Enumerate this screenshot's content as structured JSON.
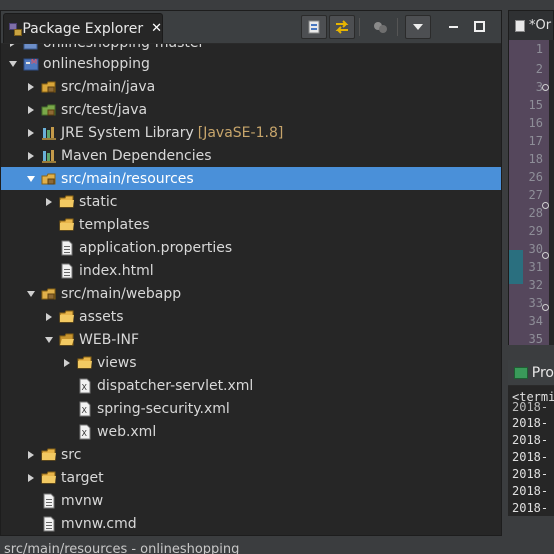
{
  "explorer": {
    "tab_title": "Package Explorer",
    "close_glyph": "✕",
    "rows": [
      {
        "label": "onlineshopping-master",
        "decor": ""
      },
      {
        "label": "onlineshopping",
        "decor": ""
      },
      {
        "label": "src/main/java",
        "decor": ""
      },
      {
        "label": "src/test/java",
        "decor": ""
      },
      {
        "label": "JRE System Library",
        "decor": "[JavaSE-1.8]"
      },
      {
        "label": "Maven Dependencies",
        "decor": ""
      },
      {
        "label": "src/main/resources",
        "decor": ""
      },
      {
        "label": "static",
        "decor": ""
      },
      {
        "label": "templates",
        "decor": ""
      },
      {
        "label": "application.properties",
        "decor": ""
      },
      {
        "label": "index.html",
        "decor": ""
      },
      {
        "label": "src/main/webapp",
        "decor": ""
      },
      {
        "label": "assets",
        "decor": ""
      },
      {
        "label": "WEB-INF",
        "decor": ""
      },
      {
        "label": "views",
        "decor": ""
      },
      {
        "label": "dispatcher-servlet.xml",
        "decor": ""
      },
      {
        "label": "spring-security.xml",
        "decor": ""
      },
      {
        "label": "web.xml",
        "decor": ""
      },
      {
        "label": "src",
        "decor": ""
      },
      {
        "label": "target",
        "decor": ""
      },
      {
        "label": "mvnw",
        "decor": ""
      },
      {
        "label": "mvnw.cmd",
        "decor": ""
      }
    ]
  },
  "editor": {
    "tab_title": "*Or",
    "line_numbers": [
      "1",
      "2",
      "3",
      "15",
      "16",
      "17",
      "18",
      "26",
      "27",
      "28",
      "29",
      "30",
      "31",
      "32",
      "33",
      "34",
      "35",
      "36",
      "37"
    ]
  },
  "console": {
    "tab_title": "Pro",
    "lines": [
      "<termi",
      "2018-",
      "2018-",
      "2018-",
      "2018-",
      "2018-",
      "2018-",
      "2018-"
    ]
  },
  "status": {
    "text": "src/main/resources - onlineshopping"
  },
  "colors": {
    "selection": "#4a90d9",
    "view_background": "#262626",
    "toolbar_background": "#3c3f41",
    "gutter": "#55475c",
    "decoration": "#c7a56b"
  }
}
